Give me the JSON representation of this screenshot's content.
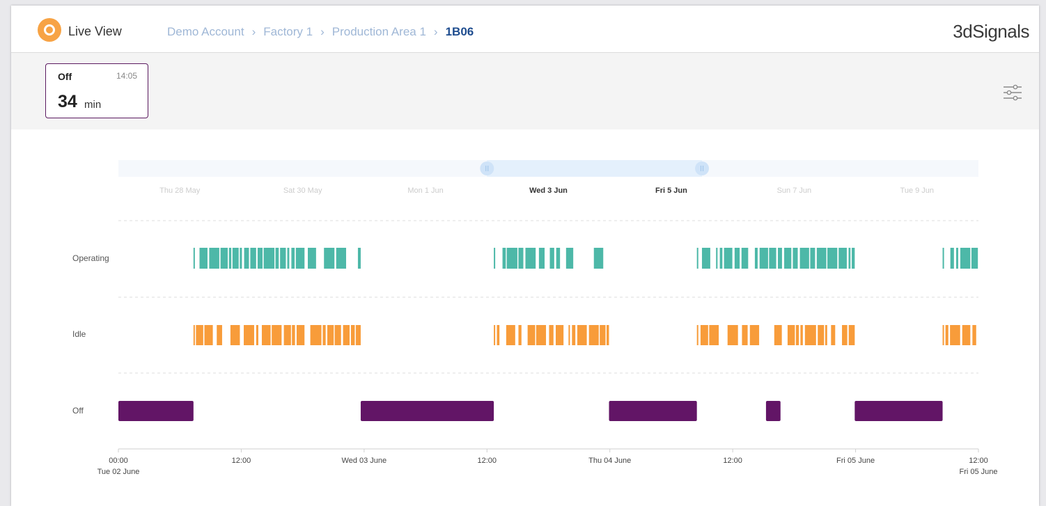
{
  "header": {
    "live_view_label": "Live View",
    "breadcrumbs": [
      "Demo Account",
      "Factory 1",
      "Production Area 1"
    ],
    "current_machine": "1B06",
    "brand_name": "3dSignals"
  },
  "status_card": {
    "status": "Off",
    "time": "14:05",
    "duration_value": "34",
    "duration_unit": "min"
  },
  "icons": {
    "live_view": "live-indicator-icon",
    "settings": "sliders-icon",
    "separator": "chevron-right-icon"
  },
  "colors": {
    "operating": "#4db8a8",
    "idle": "#f89c3a",
    "off": "#621566",
    "live_accent": "#f7a345",
    "breadcrumb": "#9fb7d6",
    "breadcrumb_current": "#1f4d8f"
  },
  "chart_data": {
    "type": "timeline",
    "rows": [
      "Operating",
      "Idle",
      "Off"
    ],
    "x_ticks": [
      {
        "time": "2020-06-02T00:00",
        "line1": "00:00",
        "line2": "Tue 02 June"
      },
      {
        "time": "2020-06-02T12:00",
        "line1": "12:00",
        "line2": ""
      },
      {
        "time": "2020-06-03T00:00",
        "line1": "Wed 03 June",
        "line2": ""
      },
      {
        "time": "2020-06-03T12:00",
        "line1": "12:00",
        "line2": ""
      },
      {
        "time": "2020-06-04T00:00",
        "line1": "Thu 04 June",
        "line2": ""
      },
      {
        "time": "2020-06-04T12:00",
        "line1": "12:00",
        "line2": ""
      },
      {
        "time": "2020-06-05T00:00",
        "line1": "Fri 05 June",
        "line2": ""
      },
      {
        "time": "2020-06-05T12:00",
        "line1": "12:00",
        "line2": "Fri 05 June"
      }
    ],
    "x_range": [
      "2020-06-02T00:00",
      "2020-06-05T12:00"
    ],
    "overview": {
      "range": [
        "2020-05-27T00:00",
        "2020-06-10T00:00"
      ],
      "window": [
        "2020-06-02T00:00",
        "2020-06-05T12:00"
      ],
      "labels": [
        {
          "time": "2020-05-28T00:00",
          "text": "Thu 28 May"
        },
        {
          "time": "2020-05-30T00:00",
          "text": "Sat 30 May"
        },
        {
          "time": "2020-06-01T00:00",
          "text": "Mon 1 Jun"
        },
        {
          "time": "2020-06-03T00:00",
          "text": "Wed 3 Jun"
        },
        {
          "time": "2020-06-05T00:00",
          "text": "Fri 5 Jun"
        },
        {
          "time": "2020-06-07T00:00",
          "text": "Sun 7 Jun"
        },
        {
          "time": "2020-06-09T00:00",
          "text": "Tue 9 Jun"
        }
      ]
    },
    "off_segments": [
      [
        "2020-06-02T00:00",
        "2020-06-02T07:20"
      ],
      [
        "2020-06-02T23:40",
        "2020-06-03T12:40"
      ],
      [
        "2020-06-03T23:55",
        "2020-06-04T08:30"
      ],
      [
        "2020-06-04T15:15",
        "2020-06-04T16:40"
      ],
      [
        "2020-06-04T23:55",
        "2020-06-05T08:30"
      ]
    ],
    "active_blocks": [
      {
        "operating": [
          "2020-06-02T07:20",
          "2020-06-02T23:40"
        ],
        "idle": [
          "2020-06-02T07:20",
          "2020-06-02T23:40"
        ]
      },
      {
        "operating": [
          "2020-06-03T12:40",
          "2020-06-03T23:55"
        ],
        "idle": [
          "2020-06-03T12:40",
          "2020-06-03T23:55"
        ]
      },
      {
        "operating": [
          "2020-06-04T08:30",
          "2020-06-04T23:55"
        ],
        "idle": [
          "2020-06-04T08:30",
          "2020-06-04T23:55"
        ]
      },
      {
        "operating": [
          "2020-06-05T08:30",
          "2020-06-05T12:00"
        ],
        "idle": [
          "2020-06-05T08:30",
          "2020-06-05T12:00"
        ]
      }
    ],
    "grid": true
  }
}
